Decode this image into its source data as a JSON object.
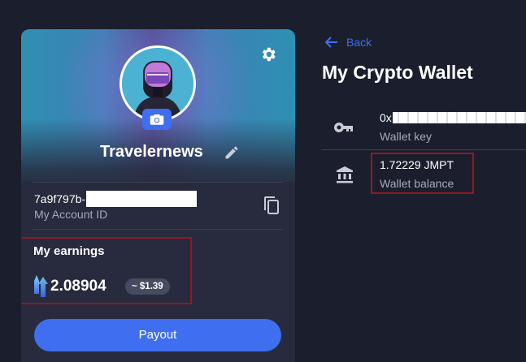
{
  "profile": {
    "username": "Travelernews",
    "account_id_prefix": "7a9f797b-",
    "account_id_label": "My Account ID"
  },
  "earnings": {
    "title": "My earnings",
    "amount": "2.08904",
    "usd_value": "~ $1.39"
  },
  "actions": {
    "payout_label": "Payout"
  },
  "wallet": {
    "back_label": "Back",
    "title": "My Crypto Wallet",
    "key_prefix": "0x",
    "key_label": "Wallet key",
    "balance_value": "1.72229 JMPT",
    "balance_label": "Wallet balance"
  },
  "icons": {
    "settings": "gear-icon",
    "camera": "camera-icon",
    "edit": "pencil-icon",
    "copy": "copy-icon",
    "token": "jmpt-logo-icon",
    "back": "arrow-left-icon",
    "key": "key-icon",
    "bank": "bank-icon"
  },
  "colors": {
    "background": "#1b1e2c",
    "card": "#272b3d",
    "accent": "#3f6ff0",
    "highlight_border": "#9c1420",
    "muted_text": "#a4a9ba"
  }
}
